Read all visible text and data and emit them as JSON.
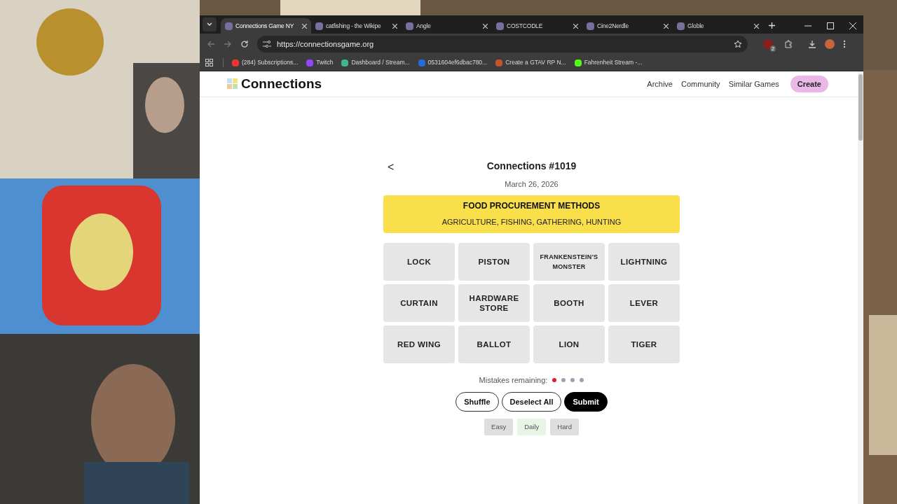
{
  "browser": {
    "tabs": [
      {
        "title": "Connections Game NY",
        "selected": true
      },
      {
        "title": "catfishing - the Wikipe",
        "selected": false
      },
      {
        "title": "Angle",
        "selected": false
      },
      {
        "title": "COSTCODLE",
        "selected": false
      },
      {
        "title": "Cine2Nerdle",
        "selected": false
      },
      {
        "title": "Globle",
        "selected": false
      }
    ],
    "url": "https://connectionsgame.org",
    "extension_badge": "2",
    "bookmarks": [
      "(284) Subscriptions...",
      "Twitch",
      "Dashboard / Stream...",
      "0531604ef6dbac780...",
      "Create a GTAV RP N...",
      "Fahrenheit Stream -..."
    ]
  },
  "site": {
    "logo": "Connections",
    "nav": [
      "Archive",
      "Community",
      "Similar Games"
    ],
    "create_button": "Create"
  },
  "game": {
    "back": "<",
    "title": "Connections #1019",
    "date": "March 26, 2026",
    "solved": [
      {
        "name": "FOOD PROCUREMENT METHODS",
        "words": "AGRICULTURE, FISHING, GATHERING, HUNTING",
        "color": "#f9df4a"
      }
    ],
    "tiles": [
      {
        "word": "LOCK",
        "selected": false
      },
      {
        "word": "PISTON",
        "selected": false
      },
      {
        "word": "FRANKENSTEIN'S MONSTER",
        "selected": false
      },
      {
        "word": "LIGHTNING",
        "selected": false
      },
      {
        "word": "CURTAIN",
        "selected": false
      },
      {
        "word": "HARDWARE STORE",
        "selected": false
      },
      {
        "word": "BOOTH",
        "selected": false
      },
      {
        "word": "LEVER",
        "selected": false
      },
      {
        "word": "RED WING",
        "selected": false
      },
      {
        "word": "BALLOT",
        "selected": false
      },
      {
        "word": "LION",
        "selected": false
      },
      {
        "word": "TIGER",
        "selected": false
      }
    ],
    "mistakes_label": "Mistakes remaining:",
    "mistake_dots": [
      {
        "color": "#e11d2a"
      },
      {
        "color": "#9ca3af"
      },
      {
        "color": "#9ca3af"
      },
      {
        "color": "#9ca3af"
      }
    ],
    "buttons": [
      {
        "label": "Shuffle",
        "kind": "outline"
      },
      {
        "label": "Deselect All",
        "kind": "outline"
      },
      {
        "label": "Submit",
        "kind": "filled"
      }
    ],
    "modes": [
      {
        "label": "Easy",
        "selected": false
      },
      {
        "label": "Daily",
        "selected": true
      },
      {
        "label": "Hard",
        "selected": false
      }
    ]
  }
}
